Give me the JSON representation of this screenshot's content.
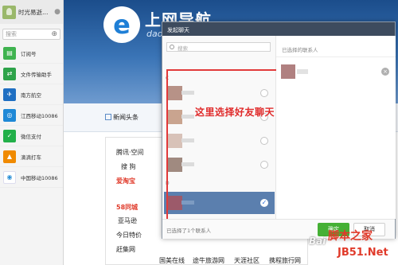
{
  "sidebar": {
    "user_name": "时光易逝…",
    "search_placeholder": "搜索",
    "items": [
      {
        "label": "订阅号",
        "icon": "subscription-icon",
        "color": "#3fb34f",
        "glyph": "▤"
      },
      {
        "label": "文件传输助手",
        "icon": "file-transfer-icon",
        "color": "#2ea34a",
        "glyph": "⇄"
      },
      {
        "label": "南方航空",
        "icon": "airline-icon",
        "color": "#1f6fc2",
        "glyph": "✈"
      },
      {
        "label": "江西移动10086",
        "icon": "mobile-carrier-icon",
        "color": "#1e88d6",
        "glyph": "◎"
      },
      {
        "label": "微信支付",
        "icon": "wechat-pay-icon",
        "color": "#22b04a",
        "glyph": "✓"
      },
      {
        "label": "滴滴打车",
        "icon": "didi-icon",
        "color": "#f08a00",
        "glyph": "▲"
      },
      {
        "label": "中国移动10086",
        "icon": "china-mobile-icon",
        "color": "#ffffff",
        "glyph": "◉"
      }
    ]
  },
  "browser": {
    "logo_letter": "e",
    "logo_cn": "上网导航",
    "logo_en": "daohang",
    "nav_news": "新闻头条",
    "links": [
      {
        "text": "腾讯·空间",
        "color": "#222"
      },
      {
        "text": "搜 狗",
        "color": "#222"
      },
      {
        "text": "爱淘宝",
        "color": "#e03a2a"
      },
      {
        "text": "58同城",
        "color": "#e03a2a"
      },
      {
        "text": "亚马逊",
        "color": "#222"
      },
      {
        "text": "今日特价",
        "color": "#222"
      },
      {
        "text": "赶集网",
        "color": "#222"
      },
      {
        "text": "国美在线",
        "color": "#222"
      },
      {
        "text": "途牛旅游网",
        "color": "#222"
      },
      {
        "text": "天涯社区",
        "color": "#222"
      },
      {
        "text": "携程旅行网",
        "color": "#222"
      }
    ]
  },
  "dialog": {
    "title": "发起聊天",
    "search_placeholder": "搜索",
    "section_letter": "C",
    "section_letter_2": "D",
    "annotation": "这里选择好友聊天",
    "selected_label": "已选择的联系人",
    "selected_count_text": "已选择了1个联系人",
    "ok_label": "确定",
    "cancel_label": "取消"
  },
  "watermark": {
    "baidu": "Bai",
    "site": "脚本之家",
    "domain": "JB51.Net"
  }
}
